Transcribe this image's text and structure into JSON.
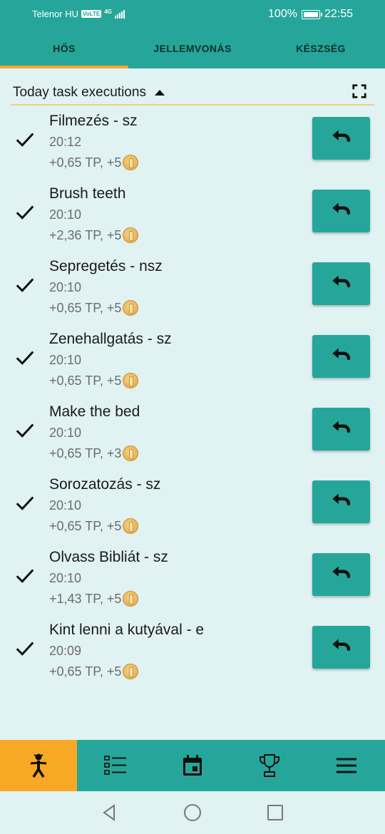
{
  "status_bar": {
    "carrier": "Telenor HU",
    "volte": "VoLTE",
    "network": "4G",
    "battery": "100%",
    "time": "22:55"
  },
  "tabs": [
    {
      "label": "HŐS",
      "active": true
    },
    {
      "label": "JELLEMVONÁS",
      "active": false
    },
    {
      "label": "KÉSZSÉG",
      "active": false
    }
  ],
  "section": {
    "title": "Today task executions",
    "fullscreen_icon": "fullscreen-icon"
  },
  "tasks": [
    {
      "title": "Filmezés - sz",
      "time": "20:12",
      "reward": "+0,65 TP, +5"
    },
    {
      "title": "Brush teeth",
      "time": "20:10",
      "reward": "+2,36 TP, +5"
    },
    {
      "title": "Sepregetés - nsz",
      "time": "20:10",
      "reward": "+0,65 TP, +5"
    },
    {
      "title": "Zenehallgatás - sz",
      "time": "20:10",
      "reward": "+0,65 TP, +5"
    },
    {
      "title": "Make the bed",
      "time": "20:10",
      "reward": "+0,65 TP, +3"
    },
    {
      "title": "Sorozatozás - sz",
      "time": "20:10",
      "reward": "+0,65 TP, +5"
    },
    {
      "title": "Olvass Bibliát - sz",
      "time": "20:10",
      "reward": "+1,43 TP, +5"
    },
    {
      "title": "Kint lenni a kutyával - e",
      "time": "20:09",
      "reward": "+0,65 TP, +5"
    }
  ],
  "bottom_nav": [
    {
      "icon": "hero-icon",
      "active": true
    },
    {
      "icon": "task-list-icon",
      "active": false
    },
    {
      "icon": "calendar-icon",
      "active": false
    },
    {
      "icon": "trophy-icon",
      "active": false
    },
    {
      "icon": "menu-icon",
      "active": false
    }
  ],
  "colors": {
    "primary": "#26a69a",
    "accent": "#f9a825",
    "background": "#e0f2f1"
  }
}
